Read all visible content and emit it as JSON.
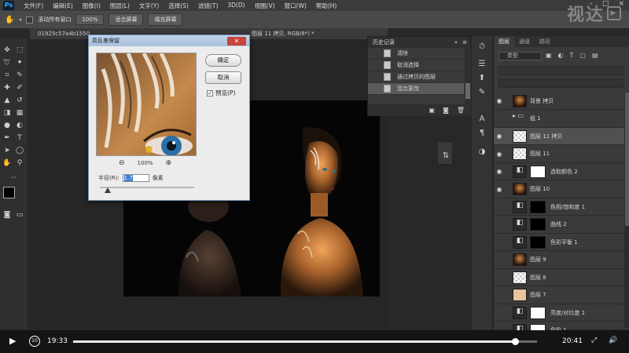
{
  "menubar": {
    "app_logo": "Ps",
    "items": [
      "文件(F)",
      "编辑(E)",
      "图像(I)",
      "图层(L)",
      "文字(Y)",
      "选择(S)",
      "滤镜(T)",
      "3D(D)",
      "视图(V)",
      "窗口(W)",
      "帮助(H)"
    ]
  },
  "options_bar": {
    "scroll_all_label": "滚动所有窗口",
    "zoom_value": "100%",
    "fit_screen": "适合屏幕",
    "fill_screen": "填充屏幕"
  },
  "watermark": "视达",
  "doc_tabs": {
    "left_tab": "01925c57a4b1550",
    "right_tab": "图层 11 拷贝, RGB/8*) *"
  },
  "dialog": {
    "title": "高反差保留",
    "ok": "确定",
    "cancel": "取消",
    "preview": "预览(P)",
    "zoom": "100%",
    "radius_label": "半径(R):",
    "radius_value": "1.7",
    "radius_unit": "像素",
    "preview_checked": true
  },
  "history": {
    "title": "历史记录",
    "items": [
      "清除",
      "取消选择",
      "通过拷贝的图层",
      "混合更改"
    ],
    "selected_index": 3
  },
  "layers": {
    "tabs": [
      "图层",
      "通道",
      "路径"
    ],
    "filter_label": "类型",
    "rows": [
      {
        "name": "背景 拷贝",
        "thumb": "photo",
        "mask": "none",
        "visible": true
      },
      {
        "name": "组 1",
        "thumb": "folder",
        "mask": "none",
        "visible": false
      },
      {
        "name": "图层 11 拷贝",
        "thumb": "checker",
        "mask": "none",
        "visible": true
      },
      {
        "name": "图层 11",
        "thumb": "checker",
        "mask": "none",
        "visible": true
      },
      {
        "name": "选取颜色 2",
        "thumb": "adjust",
        "mask": "white",
        "visible": true
      },
      {
        "name": "图层 10",
        "thumb": "photo",
        "mask": "none",
        "visible": true
      },
      {
        "name": "色相/饱和度 1",
        "thumb": "adjust",
        "mask": "black",
        "visible": false
      },
      {
        "name": "曲线 2",
        "thumb": "adjust",
        "mask": "black",
        "visible": false
      },
      {
        "name": "色彩平衡 1",
        "thumb": "adjust",
        "mask": "black",
        "visible": false
      },
      {
        "name": "图层 9",
        "thumb": "photo",
        "mask": "none",
        "visible": false
      },
      {
        "name": "图层 8",
        "thumb": "checker",
        "mask": "none",
        "visible": false
      },
      {
        "name": "图层 7",
        "thumb": "skin",
        "mask": "none",
        "visible": false
      },
      {
        "name": "亮度/对比度 1",
        "thumb": "adjust",
        "mask": "white",
        "visible": false
      },
      {
        "name": "色阶 1",
        "thumb": "adjust",
        "mask": "white",
        "visible": false
      }
    ]
  },
  "video": {
    "current_time": "19:33",
    "total_time": "20:41",
    "progress": 0.9525,
    "rewind_label": "10"
  }
}
